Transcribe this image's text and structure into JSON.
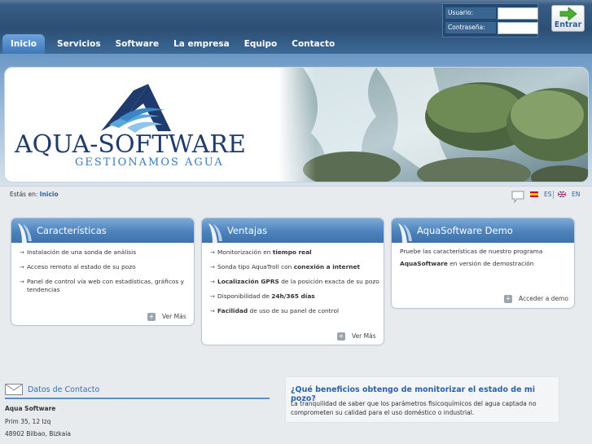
{
  "nav": {
    "items": [
      {
        "label": "Inicio"
      },
      {
        "label": "Servicios"
      },
      {
        "label": "Software"
      },
      {
        "label": "La empresa"
      },
      {
        "label": "Equipo"
      },
      {
        "label": "Contacto"
      }
    ],
    "active_index": 0
  },
  "login": {
    "user_label": "Usuario:",
    "user_value": "",
    "password_label": "Contraseña:",
    "password_value": "",
    "enter_label": "Entrar"
  },
  "logo": {
    "name": "AQUA-SOFTWARE",
    "tagline": "GESTIONAMOS AGUA"
  },
  "breadcrumb": {
    "prefix": "Estás en:",
    "current": "Inicio"
  },
  "languages": [
    {
      "code": "ES"
    },
    {
      "code": "EN"
    }
  ],
  "boxes": {
    "caracteristicas": {
      "title": "Características",
      "items": [
        "Instalación de una sonda de análisis",
        "Acceso remoto al estado de su pozo",
        "Panel de control vía web con estadísticas, gráficos y tendencias"
      ],
      "more": "Ver Más"
    },
    "ventajas": {
      "title": "Ventajas",
      "items": [
        {
          "pre": "Monitorización en ",
          "bold": "tiempo real",
          "post": ""
        },
        {
          "pre": "Sonda tipo AquaTroll con ",
          "bold": "conexión a internet",
          "post": ""
        },
        {
          "pre": "",
          "bold": "Localización GPRS",
          "post": " de la posición exacta de su pozo"
        },
        {
          "pre": "Disponibilidad de ",
          "bold": "24h/365 días",
          "post": ""
        },
        {
          "pre": "",
          "bold": "Facilidad",
          "post": " de uso de su panel de control"
        }
      ],
      "more": "Ver Más"
    },
    "demo": {
      "title": "AquaSoftware Demo",
      "line1": "Pruebe las características de nuestro programa",
      "line2_bold": "AquaSoftware",
      "line2_rest": " en versión de demostración",
      "more": "Acceder a demo"
    }
  },
  "contact": {
    "title": "Datos de Contacto",
    "company": "Aqua Software",
    "address": "Prim 35, 12 Izq",
    "city": "48902 Bilbao, Bizkaia"
  },
  "faq": {
    "question": "¿Qué beneficios obtengo de monitorizar el estado de mi pozo?",
    "answer": "La tranquilidad de saber que los parámetros fisicoquímicos del agua captada no comprometen su calidad para el uso doméstico o industrial."
  },
  "colors": {
    "accent": "#2b62a6",
    "header": "#2d4f75",
    "box_header": "#4d82bb"
  }
}
